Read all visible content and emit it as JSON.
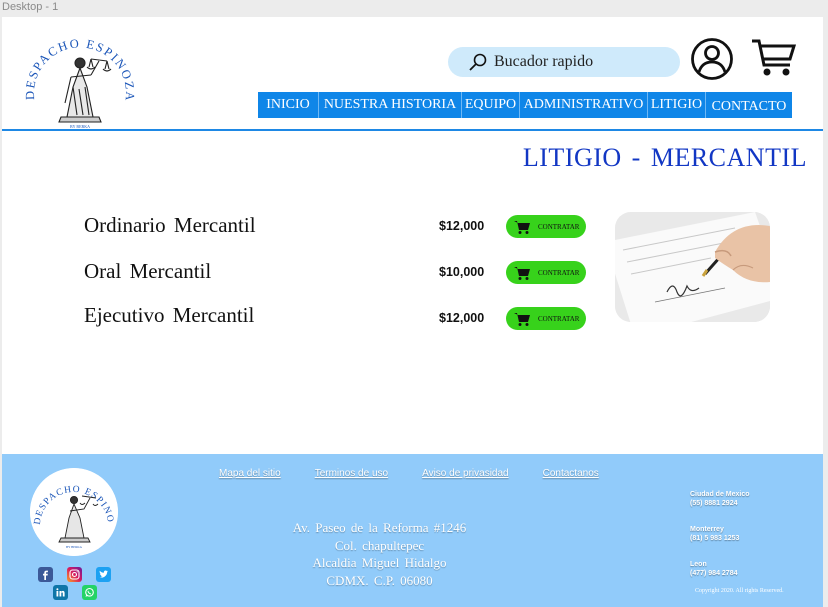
{
  "frame": {
    "label": "Desktop - 1"
  },
  "brand": {
    "logo_text": "DESPACHO ESPINOZA",
    "logo_subtext": "BY BERKA"
  },
  "search": {
    "placeholder": "Bucador rapido"
  },
  "nav": {
    "items": [
      "INICIO",
      "NUESTRA  HISTORIA",
      "EQUIPO",
      "ADMINISTRATIVO",
      "LITIGIO",
      "CONTACTO"
    ]
  },
  "page": {
    "title": "LITIGIO  -  MERCANTIL"
  },
  "services": [
    {
      "name": "Ordinario  Mercantil",
      "price": "$12,000",
      "button": "CONTRATAR"
    },
    {
      "name": "Oral  Mercantil",
      "price": "$10,000",
      "button": "CONTRATAR"
    },
    {
      "name": "Ejecutivo  Mercantil",
      "price": "$12,000",
      "button": "CONTRATAR"
    }
  ],
  "footer": {
    "links": [
      "Mapa del sitio",
      "Terminos de uso",
      "Aviso de privasidad",
      "Contactanos"
    ],
    "address": [
      "Av.  Paseo  de  la  Reforma  #1246",
      "Col.  chapultepec",
      "Alcaldia  Miguel  Hidalgo",
      "CDMX.  C.P.  06080"
    ],
    "contacts": [
      {
        "city": "Ciudad de Mexico",
        "phone": "(55) 8881 2924"
      },
      {
        "city": "Monterrey",
        "phone": "(81) 5 983 1253"
      },
      {
        "city": "Leon",
        "phone": "(477) 984 2784"
      }
    ],
    "copyright": "Copyright  2020.  All  rights  Reserved.",
    "social_icons": [
      "facebook-icon",
      "instagram-icon",
      "twitter-icon",
      "linkedin-icon",
      "whatsapp-icon"
    ]
  },
  "colors": {
    "nav_blue": "#0f86e8",
    "title_blue": "#1237c4",
    "button_green": "#37d21b",
    "footer_blue": "#91cbfa",
    "search_bg": "#cfeafb"
  }
}
